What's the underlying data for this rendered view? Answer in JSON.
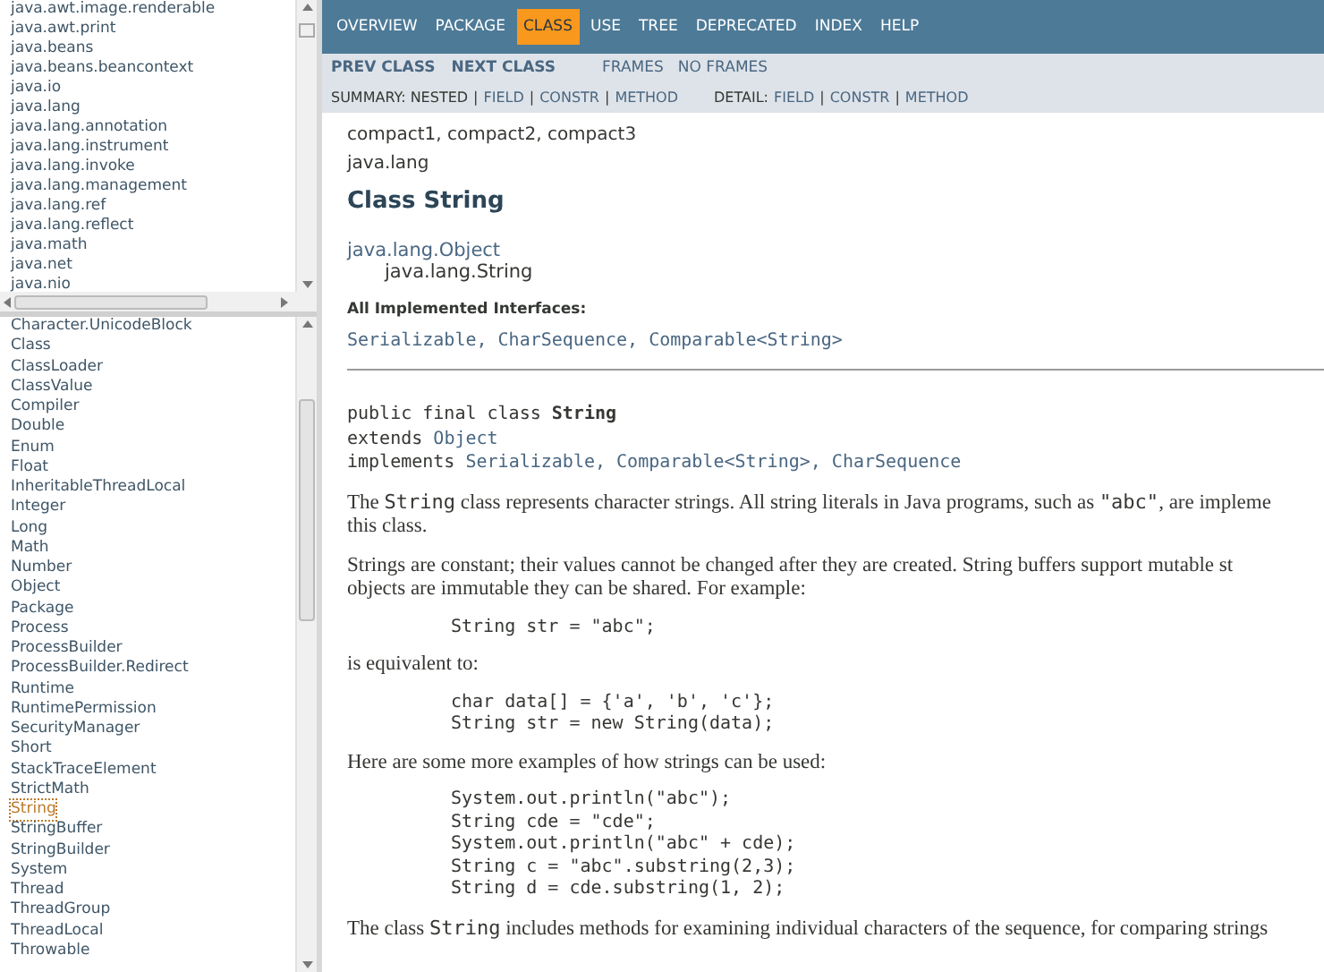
{
  "packages_frame": {
    "items": [
      {
        "label": "java.awt.image.renderable"
      },
      {
        "label": "java.awt.print"
      },
      {
        "label": "java.beans"
      },
      {
        "label": "java.beans.beancontext"
      },
      {
        "label": "java.io"
      },
      {
        "label": "java.lang"
      },
      {
        "label": "java.lang.annotation"
      },
      {
        "label": "java.lang.instrument"
      },
      {
        "label": "java.lang.invoke"
      },
      {
        "label": "java.lang.management"
      },
      {
        "label": "java.lang.ref"
      },
      {
        "label": "java.lang.reflect"
      },
      {
        "label": "java.math"
      },
      {
        "label": "java.net"
      },
      {
        "label": "java.nio"
      }
    ]
  },
  "classes_frame": {
    "items": [
      {
        "label": "Character.UnicodeBlock",
        "selected": false
      },
      {
        "label": "Class",
        "selected": false
      },
      {
        "label": "ClassLoader",
        "selected": false
      },
      {
        "label": "ClassValue",
        "selected": false
      },
      {
        "label": "Compiler",
        "selected": false
      },
      {
        "label": "Double",
        "selected": false
      },
      {
        "label": "Enum",
        "selected": false
      },
      {
        "label": "Float",
        "selected": false
      },
      {
        "label": "InheritableThreadLocal",
        "selected": false
      },
      {
        "label": "Integer",
        "selected": false
      },
      {
        "label": "Long",
        "selected": false
      },
      {
        "label": "Math",
        "selected": false
      },
      {
        "label": "Number",
        "selected": false
      },
      {
        "label": "Object",
        "selected": false
      },
      {
        "label": "Package",
        "selected": false
      },
      {
        "label": "Process",
        "selected": false
      },
      {
        "label": "ProcessBuilder",
        "selected": false
      },
      {
        "label": "ProcessBuilder.Redirect",
        "selected": false
      },
      {
        "label": "Runtime",
        "selected": false
      },
      {
        "label": "RuntimePermission",
        "selected": false
      },
      {
        "label": "SecurityManager",
        "selected": false
      },
      {
        "label": "Short",
        "selected": false
      },
      {
        "label": "StackTraceElement",
        "selected": false
      },
      {
        "label": "StrictMath",
        "selected": false
      },
      {
        "label": "String",
        "selected": true
      },
      {
        "label": "StringBuffer",
        "selected": false
      },
      {
        "label": "StringBuilder",
        "selected": false
      },
      {
        "label": "System",
        "selected": false
      },
      {
        "label": "Thread",
        "selected": false
      },
      {
        "label": "ThreadGroup",
        "selected": false
      },
      {
        "label": "ThreadLocal",
        "selected": false
      },
      {
        "label": "Throwable",
        "selected": false
      }
    ]
  },
  "top_nav": {
    "items": [
      {
        "label": "OVERVIEW",
        "selected": false
      },
      {
        "label": "PACKAGE",
        "selected": false
      },
      {
        "label": "CLASS",
        "selected": true
      },
      {
        "label": "USE",
        "selected": false
      },
      {
        "label": "TREE",
        "selected": false
      },
      {
        "label": "DEPRECATED",
        "selected": false
      },
      {
        "label": "INDEX",
        "selected": false
      },
      {
        "label": "HELP",
        "selected": false
      }
    ]
  },
  "sub_nav": {
    "prev": "PREV CLASS",
    "next": "NEXT CLASS",
    "frames": "FRAMES",
    "no_frames": "NO FRAMES",
    "summary": [
      {
        "text": "SUMMARY: NESTED",
        "link": false
      },
      {
        "text": "|",
        "link": false
      },
      {
        "text": "FIELD",
        "link": true
      },
      {
        "text": "|",
        "link": false
      },
      {
        "text": "CONSTR",
        "link": true
      },
      {
        "text": "|",
        "link": false
      },
      {
        "text": "METHOD",
        "link": true
      }
    ],
    "detail": [
      {
        "text": "DETAIL:",
        "link": false
      },
      {
        "text": "FIELD",
        "link": true
      },
      {
        "text": "|",
        "link": false
      },
      {
        "text": "CONSTR",
        "link": true
      },
      {
        "text": "|",
        "link": false
      },
      {
        "text": "METHOD",
        "link": true
      }
    ]
  },
  "content": {
    "profiles": "compact1, compact2, compact3",
    "package": "java.lang",
    "title": "Class String",
    "hierarchy": [
      {
        "label": "java.lang.Object",
        "link": true
      },
      {
        "label": "java.lang.String",
        "link": false
      }
    ],
    "interfaces_label": "All Implemented Interfaces:",
    "interfaces": "Serializable, CharSequence, Comparable<String>",
    "declaration": [
      [
        {
          "kind": "text",
          "text": "public final class "
        },
        {
          "kind": "bold",
          "text": "String"
        }
      ],
      [
        {
          "kind": "text",
          "text": "extends "
        },
        {
          "kind": "link",
          "text": "Object"
        }
      ],
      [
        {
          "kind": "text",
          "text": "implements "
        },
        {
          "kind": "link",
          "text": "Serializable, Comparable<String>, CharSequence"
        }
      ]
    ],
    "body": [
      {
        "kind": "paragraph",
        "lines": [
          [
            {
              "kind": "text",
              "text": "The "
            },
            {
              "kind": "code",
              "text": "String"
            },
            {
              "kind": "text",
              "text": " class represents character strings. All string literals in Java programs, such as "
            },
            {
              "kind": "code",
              "text": "\"abc\""
            },
            {
              "kind": "text",
              "text": ", are impleme"
            }
          ],
          [
            {
              "kind": "text",
              "text": "this class."
            }
          ]
        ]
      },
      {
        "kind": "paragraph",
        "lines": [
          [
            {
              "kind": "text",
              "text": "Strings are constant; their values cannot be changed after they are created. String buffers support mutable st"
            }
          ],
          [
            {
              "kind": "text",
              "text": "objects are immutable they can be shared. For example:"
            }
          ]
        ]
      },
      {
        "kind": "code",
        "lines": [
          "String str = \"abc\";"
        ]
      },
      {
        "kind": "paragraph",
        "lines": [
          [
            {
              "kind": "text",
              "text": "is equivalent to:"
            }
          ]
        ]
      },
      {
        "kind": "code",
        "lines": [
          "char data[] = {'a', 'b', 'c'};",
          "String str = new String(data);"
        ]
      },
      {
        "kind": "paragraph",
        "lines": [
          [
            {
              "kind": "text",
              "text": "Here are some more examples of how strings can be used:"
            }
          ]
        ]
      },
      {
        "kind": "code",
        "lines": [
          "System.out.println(\"abc\");",
          "String cde = \"cde\";",
          "System.out.println(\"abc\" + cde);",
          "String c = \"abc\".substring(2,3);",
          "String d = cde.substring(1, 2);"
        ]
      },
      {
        "kind": "paragraph",
        "lines": [
          [
            {
              "kind": "text",
              "text": "The class "
            },
            {
              "kind": "code",
              "text": "String"
            },
            {
              "kind": "text",
              "text": " includes methods for examining individual characters of the sequence, for comparing strings"
            }
          ]
        ]
      }
    ]
  }
}
